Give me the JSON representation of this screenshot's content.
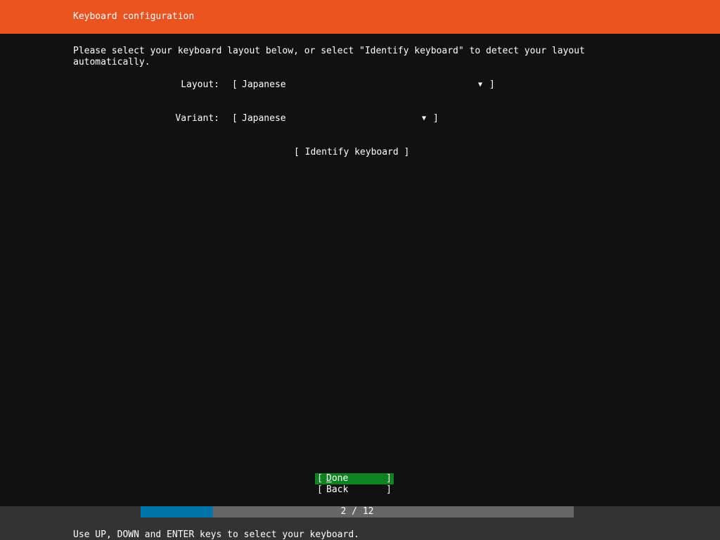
{
  "header": {
    "title": "Keyboard configuration"
  },
  "intro": "Please select your keyboard layout below, or select \"Identify keyboard\" to detect your layout automatically.",
  "layout": {
    "label": "Layout:",
    "value": "Japanese",
    "open_bracket": "[",
    "close_bracket": "]",
    "arrow": "▼"
  },
  "variant": {
    "label": "Variant:",
    "value": "Japanese",
    "open_bracket": "[",
    "close_bracket": "]",
    "arrow": "▼"
  },
  "identify_button": {
    "label": "[ Identify keyboard ]"
  },
  "buttons": {
    "done": {
      "open": "[",
      "hotkey": "D",
      "rest": "one",
      "close": "]"
    },
    "back": {
      "open": "[",
      "label": "Back",
      "close": "]"
    }
  },
  "progress": {
    "current": 2,
    "total": 12,
    "text": "2 / 12",
    "fraction": 0.1667
  },
  "status": {
    "help": "Use UP, DOWN and ENTER keys to select your keyboard."
  },
  "colors": {
    "accent": "#e95420",
    "background": "#111111",
    "selected_button": "#0e8420",
    "progress_fill": "#0073a8",
    "progress_track": "#666666",
    "status_bar": "#333333"
  }
}
